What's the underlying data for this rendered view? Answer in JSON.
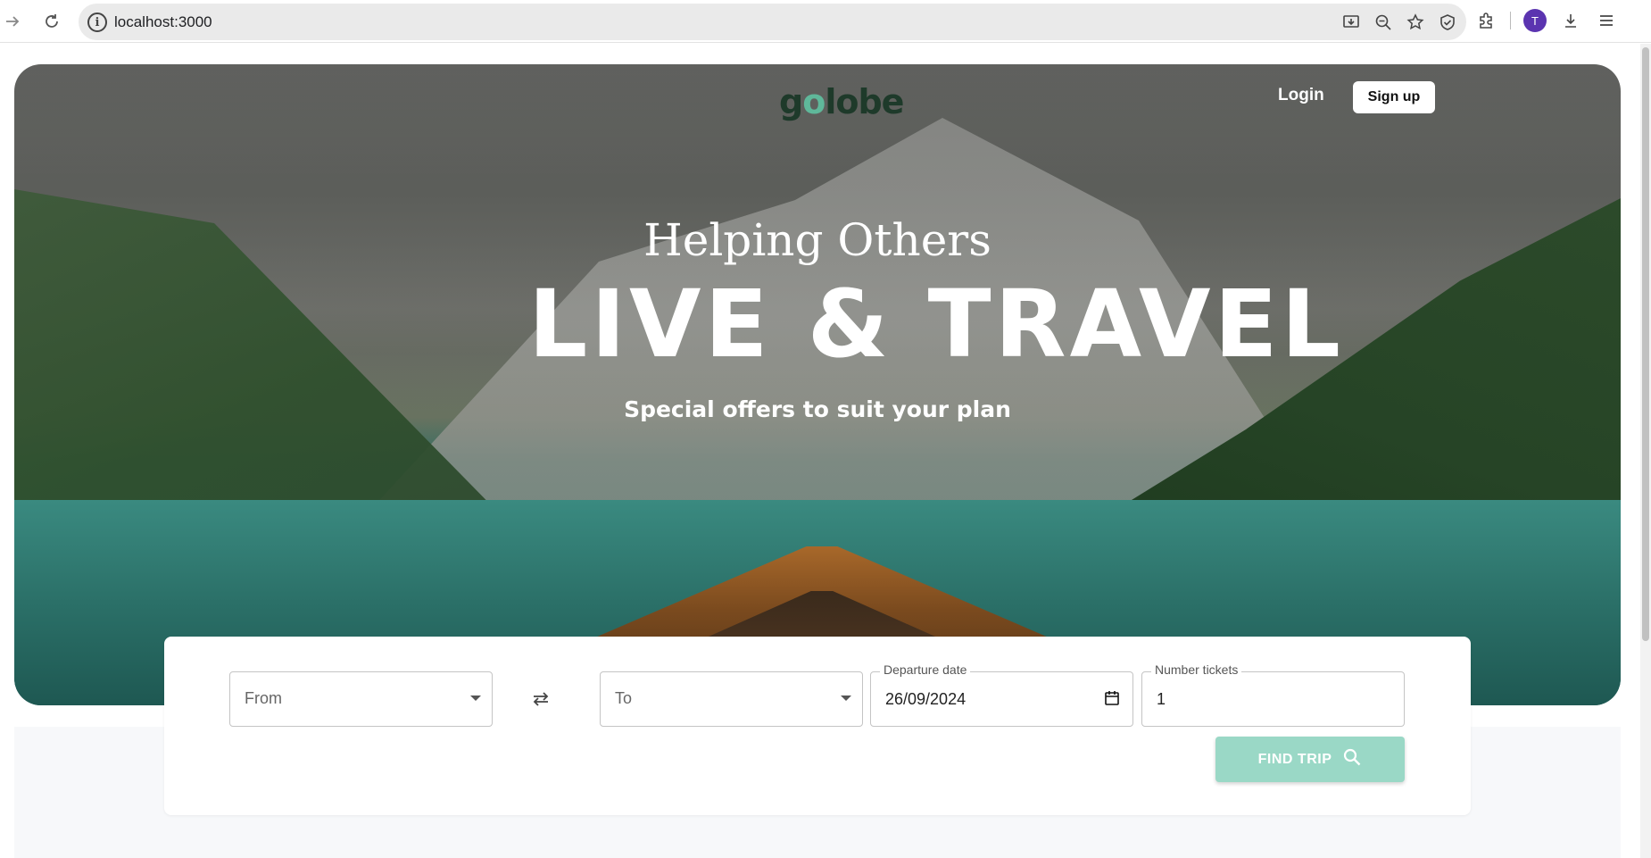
{
  "browser": {
    "url": "localhost:3000",
    "profile_initial": "T"
  },
  "nav": {
    "logo": "golobe",
    "logo_parts": [
      "g",
      "o",
      "lobe"
    ],
    "login_label": "Login",
    "signup_label": "Sign up"
  },
  "hero": {
    "subtitle": "Helping Others",
    "title": "LIVE & TRAVEL",
    "tagline": "Special offers to suit your plan"
  },
  "search": {
    "from_placeholder": "From",
    "to_placeholder": "To",
    "departure_label": "Departure date",
    "departure_value": "26/09/2024",
    "tickets_label": "Number tickets",
    "tickets_value": "1",
    "find_label": "FIND TRIP"
  },
  "colors": {
    "accent": "#9ad8c6",
    "logo_dark": "#1e3a2a",
    "logo_accent": "#5fb89a",
    "profile": "#5b34b0"
  }
}
